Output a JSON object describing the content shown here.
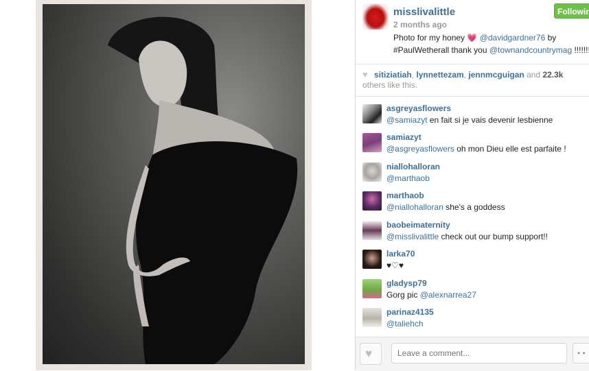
{
  "post": {
    "username": "misslivalittle",
    "time_ago": "2 months ago",
    "follow_label": "Following",
    "caption": {
      "text1": "Photo for my honey ",
      "heart": "💗",
      "mention1": "@davidgardner76",
      "text2": " by ",
      "text3": "#PaulWetherall thank you ",
      "mention2": "@townandcountrymag",
      "text4": " !!!!!!!"
    }
  },
  "likes": {
    "users": [
      "sitiziatiah",
      "lynnettezam",
      "jennmcguigan"
    ],
    "and_text": " and ",
    "count": "22.3k",
    "others_text": " others like this."
  },
  "comments": [
    {
      "user": "asgreyasflowers",
      "mention": "@samiazyt",
      "text": " en fait si je vais devenir lesbienne"
    },
    {
      "user": "samiazyt",
      "mention": "@asgreyasflowers",
      "text": " oh mon Dieu elle est parfaite !"
    },
    {
      "user": "niallohalloran",
      "mention": "@marthaob",
      "text": ""
    },
    {
      "user": "marthaob",
      "mention": "@niallohalloran",
      "text": " she's a goddess"
    },
    {
      "user": "baobeimaternity",
      "mention": "@misslivalittle",
      "text": " check out our bump support!!"
    },
    {
      "user": "larka70",
      "mention": "",
      "text": "♥♡♥"
    },
    {
      "user": "gladysp79",
      "mention": "@alexnarrea27",
      "text": "Gorg pic "
    },
    {
      "user": "parinaz4135",
      "mention": "@taliehch",
      "text": ""
    }
  ],
  "footer": {
    "comment_placeholder": "Leave a comment...",
    "more_label": "• •"
  },
  "colors": {
    "link": "#3d6f97",
    "follow": "#6fbf4b",
    "heart_pink": "#e65aa0"
  },
  "icons": {
    "like": "heart-icon",
    "more": "ellipsis-icon"
  }
}
